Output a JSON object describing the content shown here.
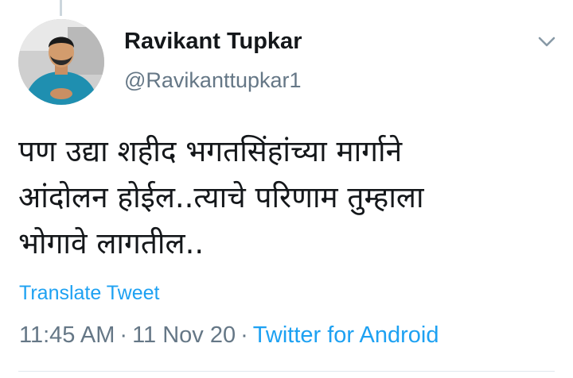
{
  "author": {
    "display_name": "Ravikant Tupkar",
    "handle": "@Ravikanttupkar1"
  },
  "tweet": {
    "lines": [
      "पण उद्या शहीद भगतसिंहांच्या मार्गाने",
      "आंदोलन होईल..त्याचे परिणाम तुम्हाला",
      "भोगावे लागतील.."
    ]
  },
  "translate_label": "Translate Tweet",
  "meta": {
    "time": "11:45 AM",
    "separator": "·",
    "date": "11 Nov 20",
    "source": "Twitter for Android"
  },
  "colors": {
    "link": "#1da1f2",
    "secondary_text": "#657786",
    "primary_text": "#14171a"
  },
  "icons": {
    "menu": "chevron-down-icon"
  }
}
